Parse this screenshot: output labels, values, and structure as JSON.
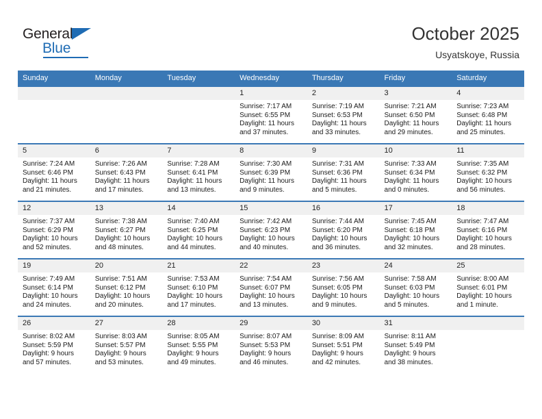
{
  "logo": {
    "word1": "General",
    "word2": "Blue",
    "triangle_color": "#1f6cb4"
  },
  "header": {
    "title": "October 2025",
    "location": "Usyatskoye, Russia",
    "accent_color": "#3a78b5"
  },
  "weekdays": [
    "Sunday",
    "Monday",
    "Tuesday",
    "Wednesday",
    "Thursday",
    "Friday",
    "Saturday"
  ],
  "weeks": [
    [
      {
        "day": "",
        "sunrise": "",
        "sunset": "",
        "daylight1": "",
        "daylight2": ""
      },
      {
        "day": "",
        "sunrise": "",
        "sunset": "",
        "daylight1": "",
        "daylight2": ""
      },
      {
        "day": "",
        "sunrise": "",
        "sunset": "",
        "daylight1": "",
        "daylight2": ""
      },
      {
        "day": "1",
        "sunrise": "Sunrise: 7:17 AM",
        "sunset": "Sunset: 6:55 PM",
        "daylight1": "Daylight: 11 hours",
        "daylight2": "and 37 minutes."
      },
      {
        "day": "2",
        "sunrise": "Sunrise: 7:19 AM",
        "sunset": "Sunset: 6:53 PM",
        "daylight1": "Daylight: 11 hours",
        "daylight2": "and 33 minutes."
      },
      {
        "day": "3",
        "sunrise": "Sunrise: 7:21 AM",
        "sunset": "Sunset: 6:50 PM",
        "daylight1": "Daylight: 11 hours",
        "daylight2": "and 29 minutes."
      },
      {
        "day": "4",
        "sunrise": "Sunrise: 7:23 AM",
        "sunset": "Sunset: 6:48 PM",
        "daylight1": "Daylight: 11 hours",
        "daylight2": "and 25 minutes."
      }
    ],
    [
      {
        "day": "5",
        "sunrise": "Sunrise: 7:24 AM",
        "sunset": "Sunset: 6:46 PM",
        "daylight1": "Daylight: 11 hours",
        "daylight2": "and 21 minutes."
      },
      {
        "day": "6",
        "sunrise": "Sunrise: 7:26 AM",
        "sunset": "Sunset: 6:43 PM",
        "daylight1": "Daylight: 11 hours",
        "daylight2": "and 17 minutes."
      },
      {
        "day": "7",
        "sunrise": "Sunrise: 7:28 AM",
        "sunset": "Sunset: 6:41 PM",
        "daylight1": "Daylight: 11 hours",
        "daylight2": "and 13 minutes."
      },
      {
        "day": "8",
        "sunrise": "Sunrise: 7:30 AM",
        "sunset": "Sunset: 6:39 PM",
        "daylight1": "Daylight: 11 hours",
        "daylight2": "and 9 minutes."
      },
      {
        "day": "9",
        "sunrise": "Sunrise: 7:31 AM",
        "sunset": "Sunset: 6:36 PM",
        "daylight1": "Daylight: 11 hours",
        "daylight2": "and 5 minutes."
      },
      {
        "day": "10",
        "sunrise": "Sunrise: 7:33 AM",
        "sunset": "Sunset: 6:34 PM",
        "daylight1": "Daylight: 11 hours",
        "daylight2": "and 0 minutes."
      },
      {
        "day": "11",
        "sunrise": "Sunrise: 7:35 AM",
        "sunset": "Sunset: 6:32 PM",
        "daylight1": "Daylight: 10 hours",
        "daylight2": "and 56 minutes."
      }
    ],
    [
      {
        "day": "12",
        "sunrise": "Sunrise: 7:37 AM",
        "sunset": "Sunset: 6:29 PM",
        "daylight1": "Daylight: 10 hours",
        "daylight2": "and 52 minutes."
      },
      {
        "day": "13",
        "sunrise": "Sunrise: 7:38 AM",
        "sunset": "Sunset: 6:27 PM",
        "daylight1": "Daylight: 10 hours",
        "daylight2": "and 48 minutes."
      },
      {
        "day": "14",
        "sunrise": "Sunrise: 7:40 AM",
        "sunset": "Sunset: 6:25 PM",
        "daylight1": "Daylight: 10 hours",
        "daylight2": "and 44 minutes."
      },
      {
        "day": "15",
        "sunrise": "Sunrise: 7:42 AM",
        "sunset": "Sunset: 6:23 PM",
        "daylight1": "Daylight: 10 hours",
        "daylight2": "and 40 minutes."
      },
      {
        "day": "16",
        "sunrise": "Sunrise: 7:44 AM",
        "sunset": "Sunset: 6:20 PM",
        "daylight1": "Daylight: 10 hours",
        "daylight2": "and 36 minutes."
      },
      {
        "day": "17",
        "sunrise": "Sunrise: 7:45 AM",
        "sunset": "Sunset: 6:18 PM",
        "daylight1": "Daylight: 10 hours",
        "daylight2": "and 32 minutes."
      },
      {
        "day": "18",
        "sunrise": "Sunrise: 7:47 AM",
        "sunset": "Sunset: 6:16 PM",
        "daylight1": "Daylight: 10 hours",
        "daylight2": "and 28 minutes."
      }
    ],
    [
      {
        "day": "19",
        "sunrise": "Sunrise: 7:49 AM",
        "sunset": "Sunset: 6:14 PM",
        "daylight1": "Daylight: 10 hours",
        "daylight2": "and 24 minutes."
      },
      {
        "day": "20",
        "sunrise": "Sunrise: 7:51 AM",
        "sunset": "Sunset: 6:12 PM",
        "daylight1": "Daylight: 10 hours",
        "daylight2": "and 20 minutes."
      },
      {
        "day": "21",
        "sunrise": "Sunrise: 7:53 AM",
        "sunset": "Sunset: 6:10 PM",
        "daylight1": "Daylight: 10 hours",
        "daylight2": "and 17 minutes."
      },
      {
        "day": "22",
        "sunrise": "Sunrise: 7:54 AM",
        "sunset": "Sunset: 6:07 PM",
        "daylight1": "Daylight: 10 hours",
        "daylight2": "and 13 minutes."
      },
      {
        "day": "23",
        "sunrise": "Sunrise: 7:56 AM",
        "sunset": "Sunset: 6:05 PM",
        "daylight1": "Daylight: 10 hours",
        "daylight2": "and 9 minutes."
      },
      {
        "day": "24",
        "sunrise": "Sunrise: 7:58 AM",
        "sunset": "Sunset: 6:03 PM",
        "daylight1": "Daylight: 10 hours",
        "daylight2": "and 5 minutes."
      },
      {
        "day": "25",
        "sunrise": "Sunrise: 8:00 AM",
        "sunset": "Sunset: 6:01 PM",
        "daylight1": "Daylight: 10 hours",
        "daylight2": "and 1 minute."
      }
    ],
    [
      {
        "day": "26",
        "sunrise": "Sunrise: 8:02 AM",
        "sunset": "Sunset: 5:59 PM",
        "daylight1": "Daylight: 9 hours",
        "daylight2": "and 57 minutes."
      },
      {
        "day": "27",
        "sunrise": "Sunrise: 8:03 AM",
        "sunset": "Sunset: 5:57 PM",
        "daylight1": "Daylight: 9 hours",
        "daylight2": "and 53 minutes."
      },
      {
        "day": "28",
        "sunrise": "Sunrise: 8:05 AM",
        "sunset": "Sunset: 5:55 PM",
        "daylight1": "Daylight: 9 hours",
        "daylight2": "and 49 minutes."
      },
      {
        "day": "29",
        "sunrise": "Sunrise: 8:07 AM",
        "sunset": "Sunset: 5:53 PM",
        "daylight1": "Daylight: 9 hours",
        "daylight2": "and 46 minutes."
      },
      {
        "day": "30",
        "sunrise": "Sunrise: 8:09 AM",
        "sunset": "Sunset: 5:51 PM",
        "daylight1": "Daylight: 9 hours",
        "daylight2": "and 42 minutes."
      },
      {
        "day": "31",
        "sunrise": "Sunrise: 8:11 AM",
        "sunset": "Sunset: 5:49 PM",
        "daylight1": "Daylight: 9 hours",
        "daylight2": "and 38 minutes."
      },
      {
        "day": "",
        "sunrise": "",
        "sunset": "",
        "daylight1": "",
        "daylight2": ""
      }
    ]
  ]
}
